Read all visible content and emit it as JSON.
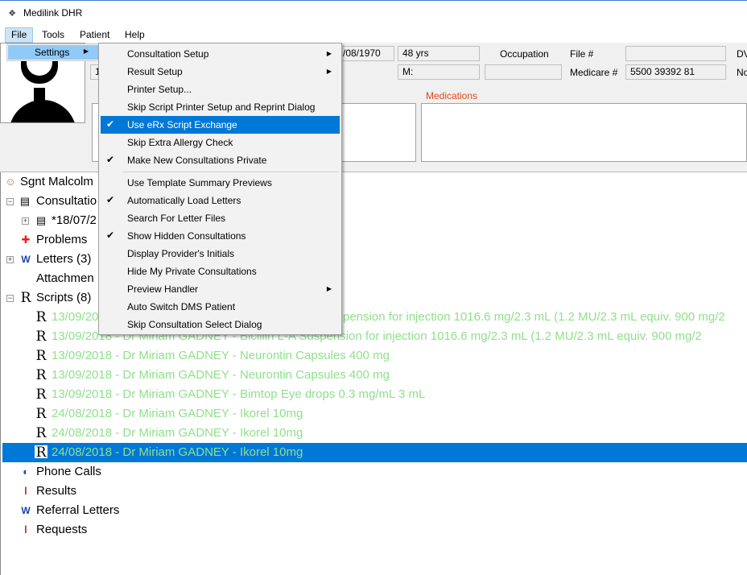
{
  "window": {
    "title": "Medilink DHR"
  },
  "menubar": {
    "items": [
      "File",
      "Tools",
      "Patient",
      "Help"
    ]
  },
  "file_menu": {
    "settings_label": "Settings"
  },
  "settings_submenu": {
    "items": [
      {
        "label": "Consultation Setup",
        "checked": false,
        "submenu": true
      },
      {
        "label": "Result Setup",
        "checked": false,
        "submenu": true
      },
      {
        "label": "Printer Setup...",
        "checked": false,
        "submenu": false
      },
      {
        "label": "Skip Script Printer Setup and Reprint Dialog",
        "checked": false,
        "submenu": false
      },
      {
        "label": "Use eRx Script Exchange",
        "checked": true,
        "submenu": false,
        "highlighted": true
      },
      {
        "label": "Skip Extra Allergy Check",
        "checked": false,
        "submenu": false
      },
      {
        "label": "Make New Consultations Private",
        "checked": true,
        "submenu": false
      },
      {
        "label": "Use Template Summary Previews",
        "checked": false,
        "submenu": false
      },
      {
        "label": "Automatically Load Letters",
        "checked": true,
        "submenu": false
      },
      {
        "label": "Search For Letter Files",
        "checked": false,
        "submenu": false
      },
      {
        "label": "Show Hidden Consultations",
        "checked": true,
        "submenu": false
      },
      {
        "label": "Display Provider's Initials",
        "checked": false,
        "submenu": false
      },
      {
        "label": "Hide My Private Consultations",
        "checked": false,
        "submenu": false
      },
      {
        "label": "Preview Handler",
        "checked": false,
        "submenu": true
      },
      {
        "label": "Auto Switch DMS Patient",
        "checked": false,
        "submenu": false
      },
      {
        "label": "Skip Consultation Select Dialog",
        "checked": false,
        "submenu": false
      }
    ]
  },
  "patient": {
    "dob_partial": "/08/1970",
    "age": "48 yrs",
    "occupation_label": "Occupation",
    "file_label": "File #",
    "file_value": "",
    "dv_label": "DV",
    "row2_first": "1",
    "m_label": "M:",
    "medicare_label": "Medicare #",
    "medicare_value": "5500 39392 81",
    "no_label": "No",
    "medications_label": "Medications"
  },
  "tree": {
    "patient_name": "Sgnt Malcolm",
    "consultations": "Consultatio",
    "consult_date": "*18/07/2",
    "problems": "Problems",
    "letters": "Letters (3)",
    "attachments": "Attachmen",
    "scripts": "Scripts (8)",
    "script_rows": [
      "13/09/20",
      "13/09/2018 - Dr Miriam GADNEY - Bicillin L-A Suspension for injection 1016.6 mg/2.3 mL (1.2 MU/2.3 mL equiv. 900 mg/2",
      "13/09/2018 - Dr Miriam GADNEY - Neurontin Capsules  400 mg",
      "13/09/2018 - Dr Miriam GADNEY - Neurontin Capsules  400 mg",
      "13/09/2018 - Dr Miriam GADNEY - Bimtop Eye drops 0.3 mg/mL 3 mL",
      "24/08/2018 - Dr Miriam GADNEY - Ikorel 10mg",
      "24/08/2018 - Dr Miriam GADNEY - Ikorel 10mg",
      "24/08/2018 - Dr Miriam GADNEY - Ikorel 10mg"
    ],
    "script_row0_tail": "pension for injection 1016.6 mg/2.3 mL (1.2 MU/2.3 mL equiv. 900 mg/2",
    "phone_calls": "Phone Calls",
    "results": "Results",
    "referral_letters": "Referral Letters",
    "requests": "Requests"
  },
  "colors": {
    "script_text": "#8fe08a",
    "selection": "#0078d7",
    "menu_highlight": "#0078d7",
    "medications_label": "#e0481c"
  }
}
